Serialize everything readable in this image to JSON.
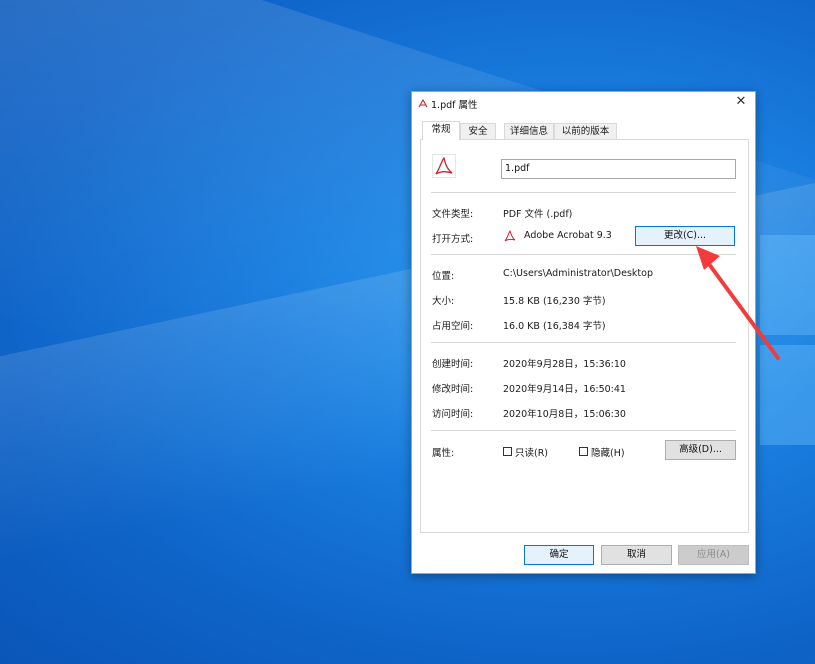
{
  "window": {
    "title": "1.pdf 属性",
    "close": "✕"
  },
  "tabs": [
    {
      "label": "常规",
      "active": true
    },
    {
      "label": "安全",
      "active": false
    },
    {
      "label": "详细信息",
      "active": false
    },
    {
      "label": "以前的版本",
      "active": false
    }
  ],
  "general": {
    "file_name": "1.pdf",
    "file_type_label": "文件类型:",
    "file_type_value": "PDF 文件 (.pdf)",
    "open_with_label": "打开方式:",
    "open_with_value": "Adobe Acrobat 9.3",
    "change_button": "更改(C)...",
    "location_label": "位置:",
    "location_value": "C:\\Users\\Administrator\\Desktop",
    "size_label": "大小:",
    "size_value": "15.8 KB (16,230 字节)",
    "size_on_disk_label": "占用空间:",
    "size_on_disk_value": "16.0 KB (16,384 字节)",
    "created_label": "创建时间:",
    "created_value": "2020年9月28日，15:36:10",
    "modified_label": "修改时间:",
    "modified_value": "2020年9月14日，16:50:41",
    "accessed_label": "访问时间:",
    "accessed_value": "2020年10月8日，15:06:30",
    "attributes_label": "属性:",
    "readonly_label": "只读(R)",
    "readonly_checked": false,
    "hidden_label": "隐藏(H)",
    "hidden_checked": false,
    "advanced_button": "高级(D)..."
  },
  "footer": {
    "ok": "确定",
    "cancel": "取消",
    "apply": "应用(A)"
  },
  "colors": {
    "accent": "#0078d7",
    "annotation_arrow": "#f23b3b",
    "pdf_icon": "#c9252c"
  },
  "icons": {
    "title_icon": "pdf-icon",
    "file_icon": "pdf-icon",
    "open_with_icon": "acrobat-icon",
    "annotation": "red-arrow-icon"
  }
}
